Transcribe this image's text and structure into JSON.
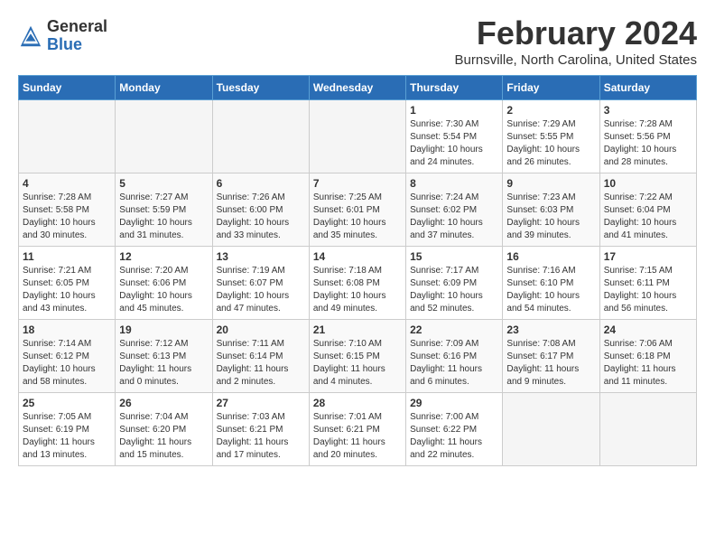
{
  "logo": {
    "general": "General",
    "blue": "Blue"
  },
  "title": "February 2024",
  "subtitle": "Burnsville, North Carolina, United States",
  "days_header": [
    "Sunday",
    "Monday",
    "Tuesday",
    "Wednesday",
    "Thursday",
    "Friday",
    "Saturday"
  ],
  "weeks": [
    [
      {
        "num": "",
        "info": ""
      },
      {
        "num": "",
        "info": ""
      },
      {
        "num": "",
        "info": ""
      },
      {
        "num": "",
        "info": ""
      },
      {
        "num": "1",
        "info": "Sunrise: 7:30 AM\nSunset: 5:54 PM\nDaylight: 10 hours\nand 24 minutes."
      },
      {
        "num": "2",
        "info": "Sunrise: 7:29 AM\nSunset: 5:55 PM\nDaylight: 10 hours\nand 26 minutes."
      },
      {
        "num": "3",
        "info": "Sunrise: 7:28 AM\nSunset: 5:56 PM\nDaylight: 10 hours\nand 28 minutes."
      }
    ],
    [
      {
        "num": "4",
        "info": "Sunrise: 7:28 AM\nSunset: 5:58 PM\nDaylight: 10 hours\nand 30 minutes."
      },
      {
        "num": "5",
        "info": "Sunrise: 7:27 AM\nSunset: 5:59 PM\nDaylight: 10 hours\nand 31 minutes."
      },
      {
        "num": "6",
        "info": "Sunrise: 7:26 AM\nSunset: 6:00 PM\nDaylight: 10 hours\nand 33 minutes."
      },
      {
        "num": "7",
        "info": "Sunrise: 7:25 AM\nSunset: 6:01 PM\nDaylight: 10 hours\nand 35 minutes."
      },
      {
        "num": "8",
        "info": "Sunrise: 7:24 AM\nSunset: 6:02 PM\nDaylight: 10 hours\nand 37 minutes."
      },
      {
        "num": "9",
        "info": "Sunrise: 7:23 AM\nSunset: 6:03 PM\nDaylight: 10 hours\nand 39 minutes."
      },
      {
        "num": "10",
        "info": "Sunrise: 7:22 AM\nSunset: 6:04 PM\nDaylight: 10 hours\nand 41 minutes."
      }
    ],
    [
      {
        "num": "11",
        "info": "Sunrise: 7:21 AM\nSunset: 6:05 PM\nDaylight: 10 hours\nand 43 minutes."
      },
      {
        "num": "12",
        "info": "Sunrise: 7:20 AM\nSunset: 6:06 PM\nDaylight: 10 hours\nand 45 minutes."
      },
      {
        "num": "13",
        "info": "Sunrise: 7:19 AM\nSunset: 6:07 PM\nDaylight: 10 hours\nand 47 minutes."
      },
      {
        "num": "14",
        "info": "Sunrise: 7:18 AM\nSunset: 6:08 PM\nDaylight: 10 hours\nand 49 minutes."
      },
      {
        "num": "15",
        "info": "Sunrise: 7:17 AM\nSunset: 6:09 PM\nDaylight: 10 hours\nand 52 minutes."
      },
      {
        "num": "16",
        "info": "Sunrise: 7:16 AM\nSunset: 6:10 PM\nDaylight: 10 hours\nand 54 minutes."
      },
      {
        "num": "17",
        "info": "Sunrise: 7:15 AM\nSunset: 6:11 PM\nDaylight: 10 hours\nand 56 minutes."
      }
    ],
    [
      {
        "num": "18",
        "info": "Sunrise: 7:14 AM\nSunset: 6:12 PM\nDaylight: 10 hours\nand 58 minutes."
      },
      {
        "num": "19",
        "info": "Sunrise: 7:12 AM\nSunset: 6:13 PM\nDaylight: 11 hours\nand 0 minutes."
      },
      {
        "num": "20",
        "info": "Sunrise: 7:11 AM\nSunset: 6:14 PM\nDaylight: 11 hours\nand 2 minutes."
      },
      {
        "num": "21",
        "info": "Sunrise: 7:10 AM\nSunset: 6:15 PM\nDaylight: 11 hours\nand 4 minutes."
      },
      {
        "num": "22",
        "info": "Sunrise: 7:09 AM\nSunset: 6:16 PM\nDaylight: 11 hours\nand 6 minutes."
      },
      {
        "num": "23",
        "info": "Sunrise: 7:08 AM\nSunset: 6:17 PM\nDaylight: 11 hours\nand 9 minutes."
      },
      {
        "num": "24",
        "info": "Sunrise: 7:06 AM\nSunset: 6:18 PM\nDaylight: 11 hours\nand 11 minutes."
      }
    ],
    [
      {
        "num": "25",
        "info": "Sunrise: 7:05 AM\nSunset: 6:19 PM\nDaylight: 11 hours\nand 13 minutes."
      },
      {
        "num": "26",
        "info": "Sunrise: 7:04 AM\nSunset: 6:20 PM\nDaylight: 11 hours\nand 15 minutes."
      },
      {
        "num": "27",
        "info": "Sunrise: 7:03 AM\nSunset: 6:21 PM\nDaylight: 11 hours\nand 17 minutes."
      },
      {
        "num": "28",
        "info": "Sunrise: 7:01 AM\nSunset: 6:21 PM\nDaylight: 11 hours\nand 20 minutes."
      },
      {
        "num": "29",
        "info": "Sunrise: 7:00 AM\nSunset: 6:22 PM\nDaylight: 11 hours\nand 22 minutes."
      },
      {
        "num": "",
        "info": ""
      },
      {
        "num": "",
        "info": ""
      }
    ]
  ]
}
